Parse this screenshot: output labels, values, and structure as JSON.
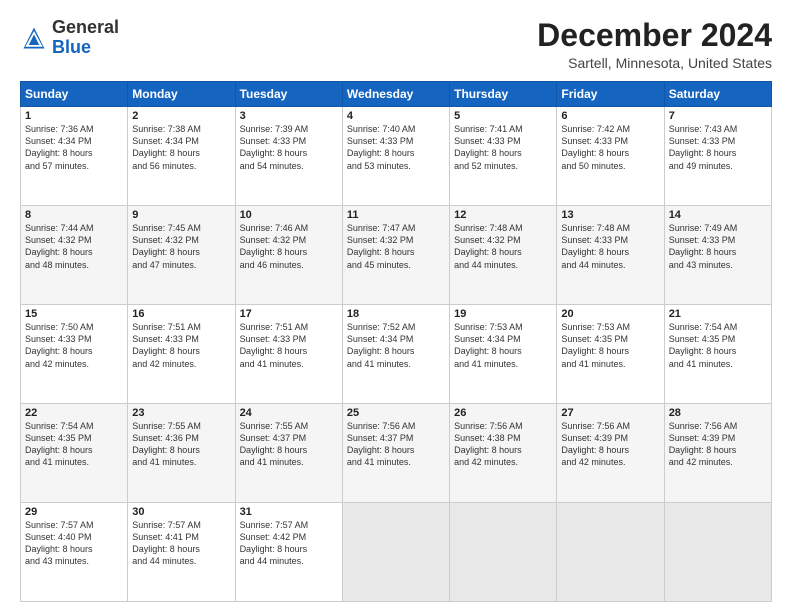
{
  "header": {
    "logo_general": "General",
    "logo_blue": "Blue",
    "title": "December 2024",
    "subtitle": "Sartell, Minnesota, United States"
  },
  "columns": [
    "Sunday",
    "Monday",
    "Tuesday",
    "Wednesday",
    "Thursday",
    "Friday",
    "Saturday"
  ],
  "weeks": [
    [
      {
        "day": "1",
        "info": "Sunrise: 7:36 AM\nSunset: 4:34 PM\nDaylight: 8 hours\nand 57 minutes."
      },
      {
        "day": "2",
        "info": "Sunrise: 7:38 AM\nSunset: 4:34 PM\nDaylight: 8 hours\nand 56 minutes."
      },
      {
        "day": "3",
        "info": "Sunrise: 7:39 AM\nSunset: 4:33 PM\nDaylight: 8 hours\nand 54 minutes."
      },
      {
        "day": "4",
        "info": "Sunrise: 7:40 AM\nSunset: 4:33 PM\nDaylight: 8 hours\nand 53 minutes."
      },
      {
        "day": "5",
        "info": "Sunrise: 7:41 AM\nSunset: 4:33 PM\nDaylight: 8 hours\nand 52 minutes."
      },
      {
        "day": "6",
        "info": "Sunrise: 7:42 AM\nSunset: 4:33 PM\nDaylight: 8 hours\nand 50 minutes."
      },
      {
        "day": "7",
        "info": "Sunrise: 7:43 AM\nSunset: 4:33 PM\nDaylight: 8 hours\nand 49 minutes."
      }
    ],
    [
      {
        "day": "8",
        "info": "Sunrise: 7:44 AM\nSunset: 4:32 PM\nDaylight: 8 hours\nand 48 minutes."
      },
      {
        "day": "9",
        "info": "Sunrise: 7:45 AM\nSunset: 4:32 PM\nDaylight: 8 hours\nand 47 minutes."
      },
      {
        "day": "10",
        "info": "Sunrise: 7:46 AM\nSunset: 4:32 PM\nDaylight: 8 hours\nand 46 minutes."
      },
      {
        "day": "11",
        "info": "Sunrise: 7:47 AM\nSunset: 4:32 PM\nDaylight: 8 hours\nand 45 minutes."
      },
      {
        "day": "12",
        "info": "Sunrise: 7:48 AM\nSunset: 4:32 PM\nDaylight: 8 hours\nand 44 minutes."
      },
      {
        "day": "13",
        "info": "Sunrise: 7:48 AM\nSunset: 4:33 PM\nDaylight: 8 hours\nand 44 minutes."
      },
      {
        "day": "14",
        "info": "Sunrise: 7:49 AM\nSunset: 4:33 PM\nDaylight: 8 hours\nand 43 minutes."
      }
    ],
    [
      {
        "day": "15",
        "info": "Sunrise: 7:50 AM\nSunset: 4:33 PM\nDaylight: 8 hours\nand 42 minutes."
      },
      {
        "day": "16",
        "info": "Sunrise: 7:51 AM\nSunset: 4:33 PM\nDaylight: 8 hours\nand 42 minutes."
      },
      {
        "day": "17",
        "info": "Sunrise: 7:51 AM\nSunset: 4:33 PM\nDaylight: 8 hours\nand 41 minutes."
      },
      {
        "day": "18",
        "info": "Sunrise: 7:52 AM\nSunset: 4:34 PM\nDaylight: 8 hours\nand 41 minutes."
      },
      {
        "day": "19",
        "info": "Sunrise: 7:53 AM\nSunset: 4:34 PM\nDaylight: 8 hours\nand 41 minutes."
      },
      {
        "day": "20",
        "info": "Sunrise: 7:53 AM\nSunset: 4:35 PM\nDaylight: 8 hours\nand 41 minutes."
      },
      {
        "day": "21",
        "info": "Sunrise: 7:54 AM\nSunset: 4:35 PM\nDaylight: 8 hours\nand 41 minutes."
      }
    ],
    [
      {
        "day": "22",
        "info": "Sunrise: 7:54 AM\nSunset: 4:35 PM\nDaylight: 8 hours\nand 41 minutes."
      },
      {
        "day": "23",
        "info": "Sunrise: 7:55 AM\nSunset: 4:36 PM\nDaylight: 8 hours\nand 41 minutes."
      },
      {
        "day": "24",
        "info": "Sunrise: 7:55 AM\nSunset: 4:37 PM\nDaylight: 8 hours\nand 41 minutes."
      },
      {
        "day": "25",
        "info": "Sunrise: 7:56 AM\nSunset: 4:37 PM\nDaylight: 8 hours\nand 41 minutes."
      },
      {
        "day": "26",
        "info": "Sunrise: 7:56 AM\nSunset: 4:38 PM\nDaylight: 8 hours\nand 42 minutes."
      },
      {
        "day": "27",
        "info": "Sunrise: 7:56 AM\nSunset: 4:39 PM\nDaylight: 8 hours\nand 42 minutes."
      },
      {
        "day": "28",
        "info": "Sunrise: 7:56 AM\nSunset: 4:39 PM\nDaylight: 8 hours\nand 42 minutes."
      }
    ],
    [
      {
        "day": "29",
        "info": "Sunrise: 7:57 AM\nSunset: 4:40 PM\nDaylight: 8 hours\nand 43 minutes."
      },
      {
        "day": "30",
        "info": "Sunrise: 7:57 AM\nSunset: 4:41 PM\nDaylight: 8 hours\nand 44 minutes."
      },
      {
        "day": "31",
        "info": "Sunrise: 7:57 AM\nSunset: 4:42 PM\nDaylight: 8 hours\nand 44 minutes."
      },
      {
        "day": "",
        "info": ""
      },
      {
        "day": "",
        "info": ""
      },
      {
        "day": "",
        "info": ""
      },
      {
        "day": "",
        "info": ""
      }
    ]
  ]
}
